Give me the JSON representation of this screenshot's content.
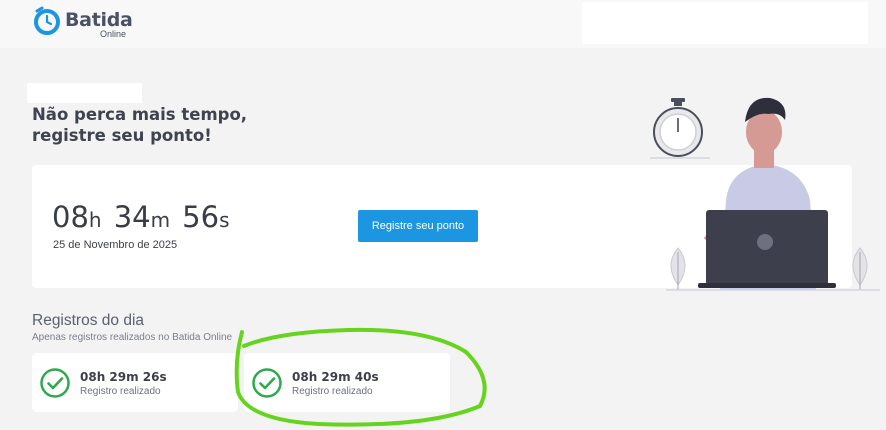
{
  "header": {
    "brand": "Batida",
    "brand_sub": "Online",
    "logo_icon": "alarm-clock-icon"
  },
  "hero": {
    "line1": "Não perca mais tempo,",
    "line2": "registre seu ponto!"
  },
  "clock": {
    "hours": "08",
    "hours_unit": "h",
    "minutes": "34",
    "minutes_unit": "m",
    "seconds": "56",
    "seconds_unit": "s",
    "date": "25 de Novembro de 2025"
  },
  "actions": {
    "register_label": "Registre seu ponto"
  },
  "records": {
    "title": "Registros do dia",
    "subtitle": "Apenas registros realizados no Batida Online",
    "items": [
      {
        "time": "08h 29m 26s",
        "status": "Registro realizado"
      },
      {
        "time": "08h 29m 40s",
        "status": "Registro realizado"
      }
    ]
  },
  "colors": {
    "accent": "#1c96e0",
    "success": "#2fa84f",
    "annotation": "#66d41e"
  }
}
